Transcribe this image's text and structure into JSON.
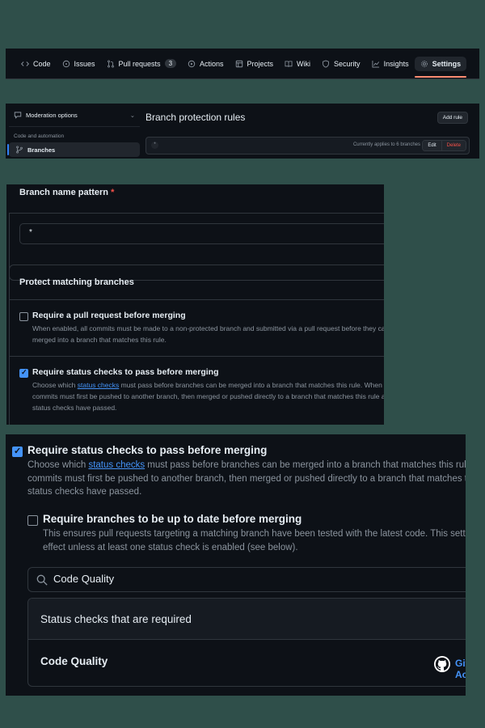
{
  "nav": {
    "tabs": [
      {
        "label": "Code",
        "icon": "code-icon"
      },
      {
        "label": "Issues",
        "icon": "issue-icon"
      },
      {
        "label": "Pull requests",
        "icon": "pull-request-icon",
        "count": "3"
      },
      {
        "label": "Actions",
        "icon": "play-icon"
      },
      {
        "label": "Projects",
        "icon": "table-icon"
      },
      {
        "label": "Wiki",
        "icon": "book-icon"
      },
      {
        "label": "Security",
        "icon": "shield-icon"
      },
      {
        "label": "Insights",
        "icon": "graph-icon"
      },
      {
        "label": "Settings",
        "icon": "gear-icon",
        "active": true
      }
    ]
  },
  "sidebar": {
    "moderation": "Moderation options",
    "section": "Code and automation",
    "branches": "Branches"
  },
  "rules": {
    "title": "Branch protection rules",
    "add_rule": "Add rule",
    "pattern_symbol": "*",
    "applies": "Currently applies to 6 branches",
    "edit": "Edit",
    "delete": "Delete"
  },
  "form": {
    "branch_pattern_label": "Branch name pattern",
    "required_mark": "*",
    "pattern_value": "*",
    "protect_title": "Protect matching branches",
    "pr_title": "Require a pull request before merging",
    "pr_desc1": "When enabled, all commits must be made to a non-protected branch and submitted via a pull request before they can be",
    "pr_desc2": "merged into a branch that matches this rule.",
    "sc_title": "Require status checks to pass before merging",
    "sc_desc1_a": "Choose which ",
    "sc_link": "status checks",
    "sc_desc1_b": " must pass before branches can be merged into a branch that matches this rule. When enabled,",
    "sc_desc2": "commits must first be pushed to another branch, then merged or pushed directly to a branch that matches this rule after",
    "sc_desc3": "status checks have passed."
  },
  "detail": {
    "sc_title": "Require status checks to pass before merging",
    "sc_desc1_a": "Choose which ",
    "sc_link": "status checks",
    "sc_desc1_b": " must pass before branches can be merged into a branch that matches this rule. When enabled,",
    "sc_desc2": "commits must first be pushed to another branch, then merged or pushed directly to a branch that matches this rule after",
    "sc_desc3": "status checks have passed.",
    "uptodate_title": "Require branches to be up to date before merging",
    "uptodate_desc1": "This ensures pull requests targeting a matching branch have been tested with the latest code. This setting will not take",
    "uptodate_desc2": "effect unless at least one status check is enabled (see below).",
    "search_value": "Code Quality",
    "table_header": "Status checks that are required",
    "check_name": "Code Quality",
    "source": "GitHub Actions"
  }
}
